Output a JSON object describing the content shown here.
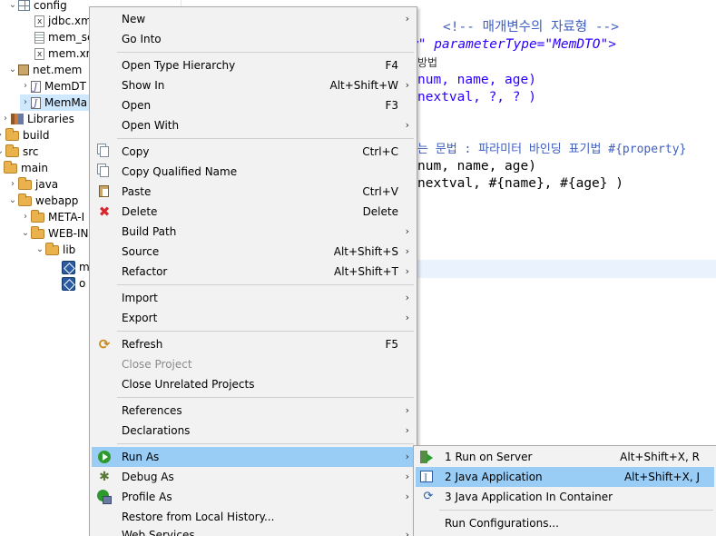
{
  "tree": {
    "items": [
      {
        "label": "config",
        "icon": "folder-grid-icon"
      },
      {
        "label": "jdbc.xm",
        "icon": "xml-file-icon"
      },
      {
        "label": "mem_sc",
        "icon": "text-file-icon"
      },
      {
        "label": "mem.xn",
        "icon": "xml-file-icon"
      },
      {
        "label": "net.mem",
        "icon": "package-icon"
      },
      {
        "label": "MemDT",
        "icon": "java-file-icon"
      },
      {
        "label": "MemMa",
        "icon": "java-file-icon"
      },
      {
        "label": "Libraries",
        "icon": "library-icon"
      },
      {
        "label": "build",
        "icon": "folder-icon"
      },
      {
        "label": "src",
        "icon": "folder-icon"
      },
      {
        "label": "main",
        "icon": "folder-icon"
      },
      {
        "label": "java",
        "icon": "folder-icon"
      },
      {
        "label": "webapp",
        "icon": "folder-icon"
      },
      {
        "label": "META-I",
        "icon": "folder-icon"
      },
      {
        "label": "WEB-IN",
        "icon": "folder-icon"
      },
      {
        "label": "lib",
        "icon": "folder-icon"
      },
      {
        "label": "m",
        "icon": "jar-icon"
      },
      {
        "label": "o",
        "icon": "jar-icon"
      }
    ]
  },
  "editor": {
    "lines": [
      {
        "text": "<!-- 매개변수의 자료형 -->"
      },
      {
        "text": "w\" parameterType=\"MemDTO\">"
      },
      {
        "text": "방법"
      },
      {
        "text": "num, name, age)"
      },
      {
        "text": "nextval, ?, ? )"
      },
      {
        "text": "는 문법 : 파라미터 바인딩 표기법 #{property}"
      },
      {
        "text": "num, name, age)"
      },
      {
        "text": "nextval, #{name}, #{age} )"
      }
    ]
  },
  "context_menu": {
    "items": [
      {
        "label": "New",
        "shortcut": "",
        "submenu": true
      },
      {
        "label": "Go Into",
        "shortcut": "",
        "submenu": false
      },
      {
        "label": "Open Type Hierarchy",
        "shortcut": "F4",
        "submenu": false
      },
      {
        "label": "Show In",
        "shortcut": "Alt+Shift+W",
        "submenu": true
      },
      {
        "label": "Open",
        "shortcut": "F3",
        "submenu": false
      },
      {
        "label": "Open With",
        "shortcut": "",
        "submenu": true
      },
      {
        "label": "Copy",
        "shortcut": "Ctrl+C",
        "submenu": false,
        "icon": "copy-icon"
      },
      {
        "label": "Copy Qualified Name",
        "shortcut": "",
        "submenu": false,
        "icon": "copy-icon"
      },
      {
        "label": "Paste",
        "shortcut": "Ctrl+V",
        "submenu": false,
        "icon": "paste-icon"
      },
      {
        "label": "Delete",
        "shortcut": "Delete",
        "submenu": false,
        "icon": "delete-icon"
      },
      {
        "label": "Build Path",
        "shortcut": "",
        "submenu": true
      },
      {
        "label": "Source",
        "shortcut": "Alt+Shift+S",
        "submenu": true
      },
      {
        "label": "Refactor",
        "shortcut": "Alt+Shift+T",
        "submenu": true
      },
      {
        "label": "Import",
        "shortcut": "",
        "submenu": true
      },
      {
        "label": "Export",
        "shortcut": "",
        "submenu": true
      },
      {
        "label": "Refresh",
        "shortcut": "F5",
        "submenu": false,
        "icon": "refresh-icon"
      },
      {
        "label": "Close Project",
        "shortcut": "",
        "submenu": false,
        "disabled": true
      },
      {
        "label": "Close Unrelated Projects",
        "shortcut": "",
        "submenu": false
      },
      {
        "label": "References",
        "shortcut": "",
        "submenu": true
      },
      {
        "label": "Declarations",
        "shortcut": "",
        "submenu": true
      },
      {
        "label": "Run As",
        "shortcut": "",
        "submenu": true,
        "active": true,
        "icon": "run-icon"
      },
      {
        "label": "Debug As",
        "shortcut": "",
        "submenu": true,
        "icon": "debug-icon"
      },
      {
        "label": "Profile As",
        "shortcut": "",
        "submenu": true,
        "icon": "profile-icon"
      },
      {
        "label": "Restore from Local History...",
        "shortcut": "",
        "submenu": false
      },
      {
        "label": "Web Services",
        "shortcut": "",
        "submenu": true
      }
    ]
  },
  "run_as_submenu": {
    "items": [
      {
        "label": "1 Run on Server",
        "shortcut": "Alt+Shift+X, R",
        "icon": "run-on-server-icon"
      },
      {
        "label": "2 Java Application",
        "shortcut": "Alt+Shift+X, J",
        "icon": "java-application-icon",
        "active": true
      },
      {
        "label": "3 Java Application In Container",
        "shortcut": "",
        "icon": "container-icon"
      },
      {
        "label": "Run Configurations...",
        "shortcut": ""
      }
    ]
  }
}
